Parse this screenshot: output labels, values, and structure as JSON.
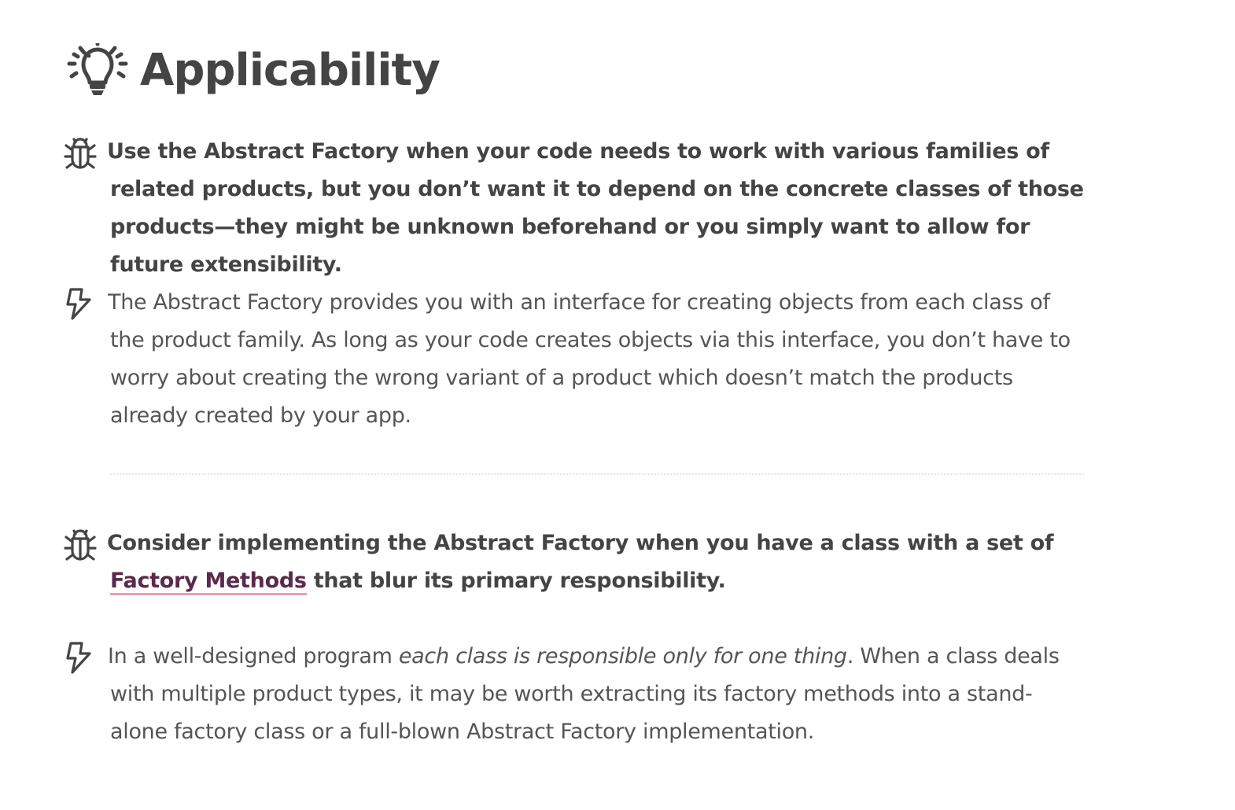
{
  "heading": {
    "title": "Applicability",
    "icon": "lightbulb-icon"
  },
  "items": [
    {
      "kind": "problem",
      "icon": "bug-icon",
      "text": "Use the Abstract Factory when your code needs to work with various families of related products, but you don’t want it to depend on the concrete classes of those products—they might be unknown beforehand or you simply want to allow for future extensibility."
    },
    {
      "kind": "solution",
      "icon": "lightning-icon",
      "text": "The Abstract Factory provides you with an interface for creating objects from each class of the product family. As long as your code creates objects via this interface, you don’t have to worry about creating the wrong variant of a product which doesn’t match the products already created by your app."
    },
    {
      "kind": "problem",
      "icon": "bug-icon",
      "text_before": "Consider implementing the Abstract Factory when you have a class with a set of ",
      "link_text": "Factory Methods",
      "text_after": " that blur its primary responsibility."
    },
    {
      "kind": "solution",
      "icon": "lightning-icon",
      "text_before": "In a well-designed program ",
      "emphasis": "each class is responsible only for one thing",
      "text_after": ". When a class deals with multiple product types, it may be worth extracting its factory methods into a stand-alone factory class or a full-blown Abstract Factory implementation."
    }
  ],
  "colors": {
    "text": "#444444",
    "link": "#5a2a4a",
    "link_underline": "#e8a0a8"
  }
}
